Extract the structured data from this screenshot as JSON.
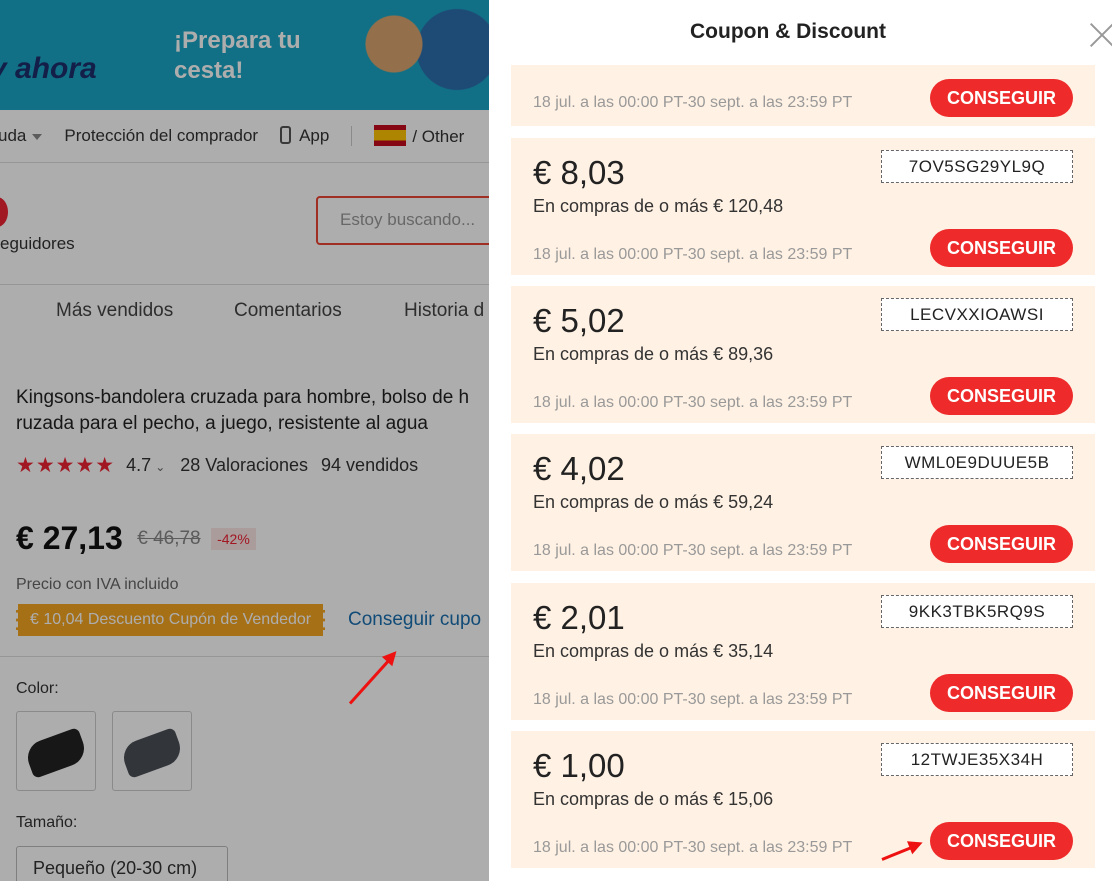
{
  "background_page": {
    "banner": {
      "left_text": "y ahora",
      "mid_text": "¡Prepara tu cesta!"
    },
    "topnav": {
      "help": "uda",
      "buyer_protection": "Protección del comprador",
      "app": "App",
      "region": "/ Other"
    },
    "followers": "eguidores",
    "search_placeholder": "Estoy buscando...",
    "tabs": [
      "Más vendidos",
      "Comentarios",
      "Historia d"
    ],
    "product_title_line1": "Kingsons-bandolera cruzada para hombre, bolso de h",
    "product_title_line2": "ruzada para el pecho, a juego, resistente al agua",
    "rating": {
      "stars": "★★★★★",
      "score": "4.7",
      "reviews": "28 Valoraciones",
      "sold": "94 vendidos"
    },
    "price": "€ 27,13",
    "old_price": "€ 46,78",
    "discount": "-42%",
    "iva_note": "Precio con IVA incluido",
    "seller_coupon": "€ 10,04 Descuento Cupón de Vendedor",
    "get_coupon_link": "Conseguir cupo",
    "color_label": "Color:",
    "size_label": "Tamaño:",
    "size_option": "Pequeño (20-30 cm)"
  },
  "panel": {
    "title": "Coupon & Discount",
    "partial_coupon": {
      "validity": "18 jul. a las 00:00 PT-30 sept. a las 23:59 PT",
      "button": "CONSEGUIR"
    },
    "coupons": [
      {
        "amount": "€ 8,03",
        "min": "En compras de o más € 120,48",
        "code": "7OV5SG29YL9Q",
        "validity": "18 jul. a las 00:00 PT-30 sept. a las 23:59 PT",
        "button": "CONSEGUIR"
      },
      {
        "amount": "€ 5,02",
        "min": "En compras de o más € 89,36",
        "code": "LECVXXIOAWSI",
        "validity": "18 jul. a las 00:00 PT-30 sept. a las 23:59 PT",
        "button": "CONSEGUIR"
      },
      {
        "amount": "€ 4,02",
        "min": "En compras de o más € 59,24",
        "code": "WML0E9DUUE5B",
        "validity": "18 jul. a las 00:00 PT-30 sept. a las 23:59 PT",
        "button": "CONSEGUIR"
      },
      {
        "amount": "€ 2,01",
        "min": "En compras de o más € 35,14",
        "code": "9KK3TBK5RQ9S",
        "validity": "18 jul. a las 00:00 PT-30 sept. a las 23:59 PT",
        "button": "CONSEGUIR"
      },
      {
        "amount": "€ 1,00",
        "min": "En compras de o más € 15,06",
        "code": "12TWJE35X34H",
        "validity": "18 jul. a las 00:00 PT-30 sept. a las 23:59 PT",
        "button": "CONSEGUIR"
      }
    ]
  },
  "colors": {
    "accent_red": "#ee2a2a",
    "coupon_bg": "#fff1e3",
    "seller_coupon_orange": "#f5a623",
    "link_blue": "#1a6fb0"
  }
}
